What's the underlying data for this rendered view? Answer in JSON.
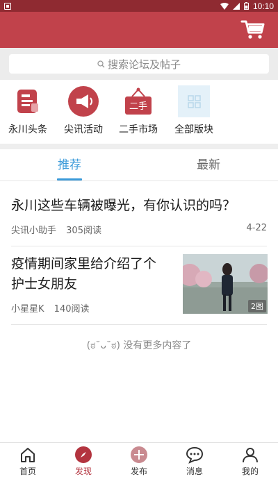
{
  "status_bar": {
    "time": "10:10"
  },
  "search": {
    "placeholder": "搜索论坛及帖子"
  },
  "categories": [
    {
      "label": "永川头条",
      "icon": "headline-icon"
    },
    {
      "label": "尖讯活动",
      "icon": "megaphone-icon"
    },
    {
      "label": "二手市场",
      "icon": "second-hand-sign-icon"
    },
    {
      "label": "全部版块",
      "icon": "all-sections-icon"
    }
  ],
  "tabs": [
    {
      "label": "推荐",
      "active": true
    },
    {
      "label": "最新",
      "active": false
    }
  ],
  "posts": [
    {
      "title": "永川这些车辆被曝光，有你认识的吗？",
      "author": "尖讯小助手",
      "views": "305阅读",
      "date": "4-22"
    },
    {
      "title_line1": "疫情期间家里给介绍了个",
      "title_line2": "护士女朋友",
      "author": "小星星K",
      "views": "140阅读",
      "image_count": "2图"
    }
  ],
  "end_text": "(ಠ˘ᴗ˘ಠ) 没有更多内容了",
  "bottom_nav": [
    {
      "label": "首页",
      "icon": "home-icon"
    },
    {
      "label": "发现",
      "icon": "compass-icon",
      "active": true
    },
    {
      "label": "发布",
      "icon": "publish-icon"
    },
    {
      "label": "消息",
      "icon": "message-icon"
    },
    {
      "label": "我的",
      "icon": "profile-icon"
    }
  ],
  "colors": {
    "header": "#c1424b",
    "status_bar": "#8f2a31",
    "accent_blue": "#3a9ad9",
    "active_nav": "#b3343f"
  }
}
